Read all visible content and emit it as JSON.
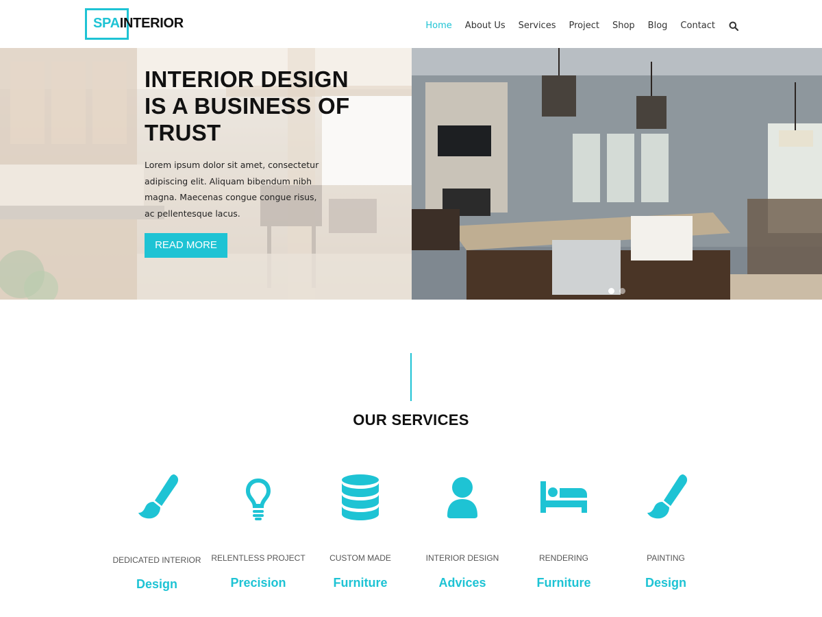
{
  "brand": {
    "logo_part1": "SPA",
    "logo_part2": "INTERIOR",
    "accent_color": "#1ec3d4"
  },
  "nav": {
    "items": [
      {
        "label": "Home",
        "active": true
      },
      {
        "label": "About Us"
      },
      {
        "label": "Services"
      },
      {
        "label": "Project"
      },
      {
        "label": "Shop"
      },
      {
        "label": "Blog"
      },
      {
        "label": "Contact"
      }
    ],
    "search_icon": "search-icon"
  },
  "hero": {
    "title": "INTERIOR DESIGN IS A BUSINESS OF TRUST",
    "text": "Lorem ipsum dolor sit amet, consectetur adipiscing elit. Aliquam bibendum nibh magna. Maecenas congue congue risus, ac pellentesque lacus.",
    "button_label": "READ MORE",
    "slides": 2,
    "active_slide": 1
  },
  "services": {
    "title": "OUR SERVICES",
    "items": [
      {
        "subtitle": "DEDICATED INTERIOR",
        "title": "Design",
        "icon": "paint-brush-icon"
      },
      {
        "subtitle": "RELENTLESS PROJECT",
        "title": "Precision",
        "icon": "lightbulb-icon"
      },
      {
        "subtitle": "CUSTOM MADE",
        "title": "Furniture",
        "icon": "database-icon"
      },
      {
        "subtitle": "INTERIOR DESIGN",
        "title": "Advices",
        "icon": "user-icon"
      },
      {
        "subtitle": "RENDERING",
        "title": "Furniture",
        "icon": "bed-icon"
      },
      {
        "subtitle": "PAINTING",
        "title": "Design",
        "icon": "paint-brush-icon"
      }
    ]
  }
}
